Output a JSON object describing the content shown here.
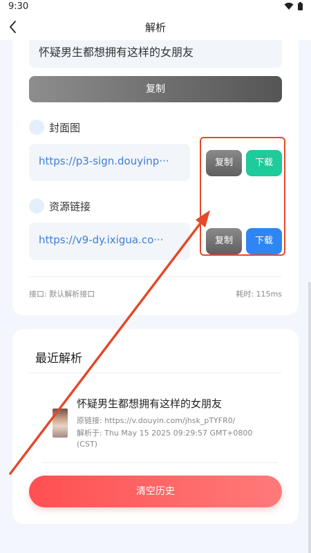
{
  "status_bar": {
    "time": "9:30"
  },
  "top_bar": {
    "title": "解析"
  },
  "parse_result": {
    "title": "怀疑男生都想拥有这样的女朋友",
    "copy_title_label": "复制",
    "cover": {
      "label": "封面图",
      "url": "https://p3-sign.douyinp···",
      "copy_label": "复制",
      "download_label": "下载"
    },
    "resource": {
      "label": "资源链接",
      "url": "https://v9-dy.ixigua.co···",
      "copy_label": "复制",
      "download_label": "下载"
    },
    "interface": "接口: 默认解析接口",
    "elapsed": "耗时: 115ms"
  },
  "recent": {
    "title": "最近解析",
    "items": [
      {
        "title": "怀疑男生都想拥有这样的女朋友",
        "source": "原链接: https://v.douyin.com/jhsk_pTYFR0/",
        "parsed_at_line1": "解析于: Thu May 15 2025 09:29:57 GMT+0800",
        "parsed_at_line2": "(CST)"
      }
    ],
    "clear_label": "清空历史"
  },
  "colors": {
    "accent_red": "#e3492a",
    "download_green": "#1ecb9a",
    "download_blue": "#2f86f2",
    "link_blue": "#3c7fd8"
  },
  "icons": {
    "back": "chevron-left-icon",
    "wifi": "wifi-icon",
    "battery": "battery-icon"
  }
}
